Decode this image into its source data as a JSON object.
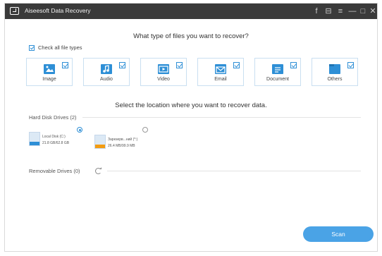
{
  "window": {
    "title": "Aiseesoft Data Recovery",
    "titlebar_icons": [
      "facebook-icon",
      "feedback-icon",
      "menu-icon",
      "minimize-icon",
      "restore-icon",
      "close-icon"
    ],
    "titlebar_glyphs": [
      "f",
      "⊟",
      "≡",
      "—",
      "□",
      "✕"
    ]
  },
  "file_types": {
    "question": "What type of files you want to recover?",
    "check_all_label": "Check all file types",
    "items": [
      {
        "label": "Image",
        "icon": "image-icon",
        "checked": true
      },
      {
        "label": "Audio",
        "icon": "audio-icon",
        "checked": true
      },
      {
        "label": "Video",
        "icon": "video-icon",
        "checked": true
      },
      {
        "label": "Email",
        "icon": "email-icon",
        "checked": true
      },
      {
        "label": "Document",
        "icon": "document-icon",
        "checked": true
      },
      {
        "label": "Others",
        "icon": "folder-icon",
        "checked": true
      }
    ]
  },
  "location": {
    "question": "Select the location where you want to recover data.",
    "hard_disk_label": "Hard Disk Drives (2)",
    "drives": [
      {
        "name": "Local Disk (C:)",
        "size": "21.8 GB/62.8 GB",
        "selected": true,
        "bar_color": "#2e8fd6"
      },
      {
        "name": "Зарезерв...ний (*:)",
        "size": "26.4 MB/99.9 MB",
        "selected": false,
        "bar_color": "#f39c12"
      }
    ],
    "removable_label": "Removable Drives (0)"
  },
  "actions": {
    "scan_label": "Scan"
  },
  "colors": {
    "accent": "#2e8fd6",
    "titlebar": "#3a3a3a",
    "scan_button": "#4aa3e6"
  }
}
